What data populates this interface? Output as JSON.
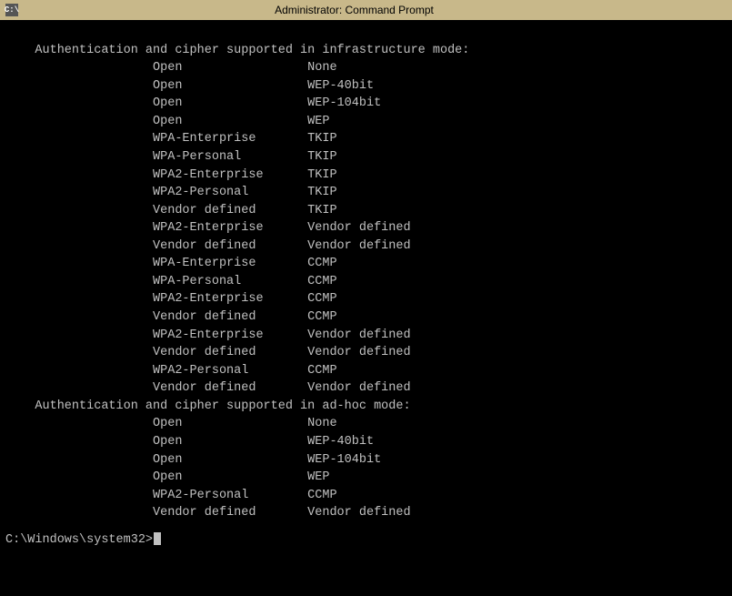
{
  "titlebar": {
    "icon_label": "C:\\",
    "title": "Administrator: Command Prompt"
  },
  "terminal": {
    "lines": [
      "    Authentication and cipher supported in infrastructure mode:",
      "                    Open                 None",
      "                    Open                 WEP-40bit",
      "                    Open                 WEP-104bit",
      "                    Open                 WEP",
      "                    WPA-Enterprise       TKIP",
      "                    WPA-Personal         TKIP",
      "                    WPA2-Enterprise      TKIP",
      "                    WPA2-Personal        TKIP",
      "                    Vendor defined       TKIP",
      "                    WPA2-Enterprise      Vendor defined",
      "                    Vendor defined       Vendor defined",
      "                    WPA-Enterprise       CCMP",
      "                    WPA-Personal         CCMP",
      "                    WPA2-Enterprise      CCMP",
      "                    Vendor defined       CCMP",
      "                    WPA2-Enterprise      Vendor defined",
      "                    Vendor defined       Vendor defined",
      "                    WPA2-Personal        CCMP",
      "                    Vendor defined       Vendor defined",
      "    Authentication and cipher supported in ad-hoc mode:",
      "                    Open                 None",
      "                    Open                 WEP-40bit",
      "                    Open                 WEP-104bit",
      "                    Open                 WEP",
      "                    WPA2-Personal        CCMP",
      "                    Vendor defined       Vendor defined"
    ],
    "prompt": "C:\\Windows\\system32>"
  }
}
